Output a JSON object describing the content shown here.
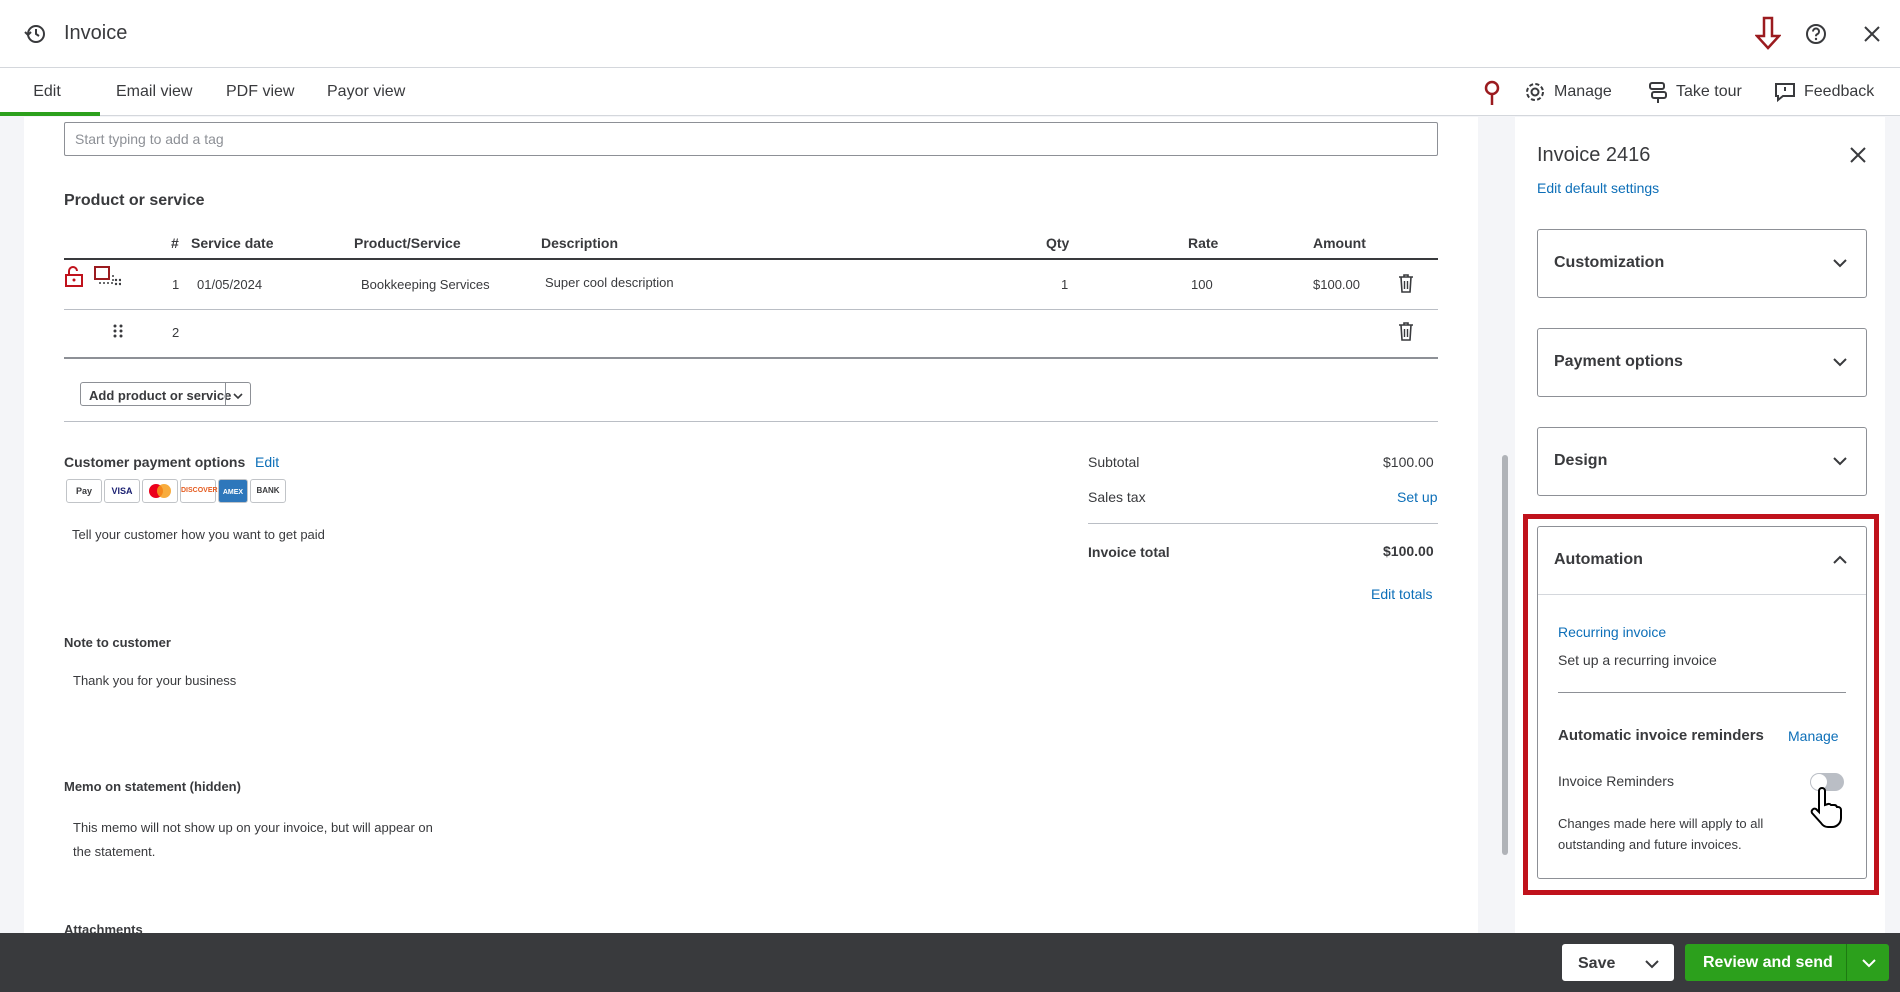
{
  "header": {
    "title": "Invoice"
  },
  "tabs": [
    {
      "label": "Edit"
    },
    {
      "label": "Email view"
    },
    {
      "label": "PDF view"
    },
    {
      "label": "Payor view"
    }
  ],
  "tools": {
    "manage": "Manage",
    "take_tour": "Take tour",
    "feedback": "Feedback"
  },
  "tags": {
    "placeholder": "Start typing to add a tag"
  },
  "product": {
    "section_title": "Product or service",
    "columns": [
      "#",
      "Service date",
      "Product/Service",
      "Description",
      "Qty",
      "Rate",
      "Amount"
    ],
    "rows": [
      {
        "num": "1",
        "date": "01/05/2024",
        "product": "Bookkeeping Services",
        "description": "Super cool description",
        "qty": "1",
        "rate": "100",
        "amount": "$100.00"
      },
      {
        "num": "2",
        "date": "",
        "product": "",
        "description": "",
        "qty": "",
        "rate": "",
        "amount": ""
      }
    ],
    "add_button": "Add product or service"
  },
  "payment": {
    "title": "Customer payment options",
    "edit": "Edit",
    "logos": [
      "Pay",
      "VISA",
      "MC",
      "DISCOVER",
      "AMEX",
      "BANK"
    ],
    "hint": "Tell your customer how you want to get paid"
  },
  "totals": {
    "subtotal_label": "Subtotal",
    "subtotal_value": "$100.00",
    "tax_label": "Sales tax",
    "tax_action": "Set up",
    "total_label": "Invoice total",
    "total_value": "$100.00",
    "edit_totals": "Edit totals"
  },
  "note": {
    "title": "Note to customer",
    "text": "Thank you for your business"
  },
  "memo": {
    "title": "Memo on statement (hidden)",
    "text_line1": "This memo will not show up on your invoice, but will appear on",
    "text_line2": "the statement."
  },
  "attachments": {
    "title": "Attachments"
  },
  "panel": {
    "title": "Invoice 2416",
    "edit_defaults": "Edit default settings",
    "sections": [
      "Customization",
      "Payment options",
      "Design",
      "Automation"
    ],
    "automation": {
      "recurring_link": "Recurring invoice",
      "recurring_desc": "Set up a recurring invoice",
      "reminders_title": "Automatic invoice reminders",
      "reminders_manage": "Manage",
      "toggle_label": "Invoice Reminders",
      "toggle_on": false,
      "note_line1": "Changes made here will apply to all",
      "note_line2": "outstanding and future invoices."
    }
  },
  "footer": {
    "save": "Save",
    "review_send": "Review and send"
  },
  "colors": {
    "accent": "#2ca01c",
    "link": "#0d6fb8",
    "highlight": "#c0121c",
    "footer": "#393a3d"
  }
}
